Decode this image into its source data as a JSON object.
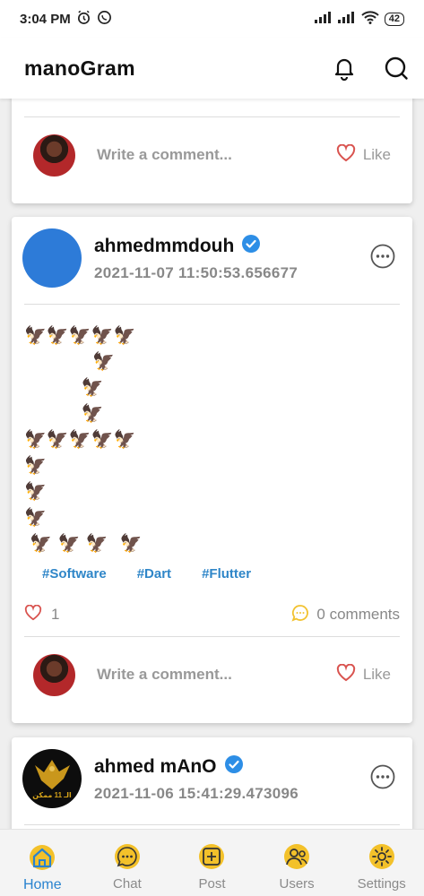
{
  "status": {
    "time": "3:04 PM",
    "battery": "42"
  },
  "app": {
    "title": "manoGram"
  },
  "card1": {
    "comment_placeholder": "Write a comment...",
    "like_label": "Like"
  },
  "post1": {
    "author": "ahmedmmdouh",
    "date": "2021-11-07 11:50:53.656677",
    "text": "🦅🦅🦅🦅🦅\n            🦅\n          🦅\n          🦅\n🦅🦅🦅🦅🦅\n🦅\n🦅\n🦅\n 🦅 🦅 🦅  🦅",
    "tags": [
      "#Software",
      "#Dart",
      "#Flutter"
    ],
    "likes": "1",
    "comments": "0 comments",
    "comment_placeholder": "Write a comment...",
    "like_label": "Like"
  },
  "post2": {
    "author": "ahmed mAnO",
    "date": "2021-11-06 15:41:29.473096",
    "avatar_text": "الـ 11 ممكن"
  },
  "nav": {
    "items": [
      {
        "label": "Home",
        "icon": "home-icon",
        "active": true
      },
      {
        "label": "Chat",
        "icon": "chat-icon",
        "active": false
      },
      {
        "label": "Post",
        "icon": "post-icon",
        "active": false
      },
      {
        "label": "Users",
        "icon": "users-icon",
        "active": false
      },
      {
        "label": "Settings",
        "icon": "settings-icon",
        "active": false
      }
    ]
  },
  "colors": {
    "accent": "#2a83cf",
    "verified": "#2d8ee6",
    "like": "#d9534f",
    "comment": "#f2c230",
    "nav_icon": "#f3c12a"
  }
}
